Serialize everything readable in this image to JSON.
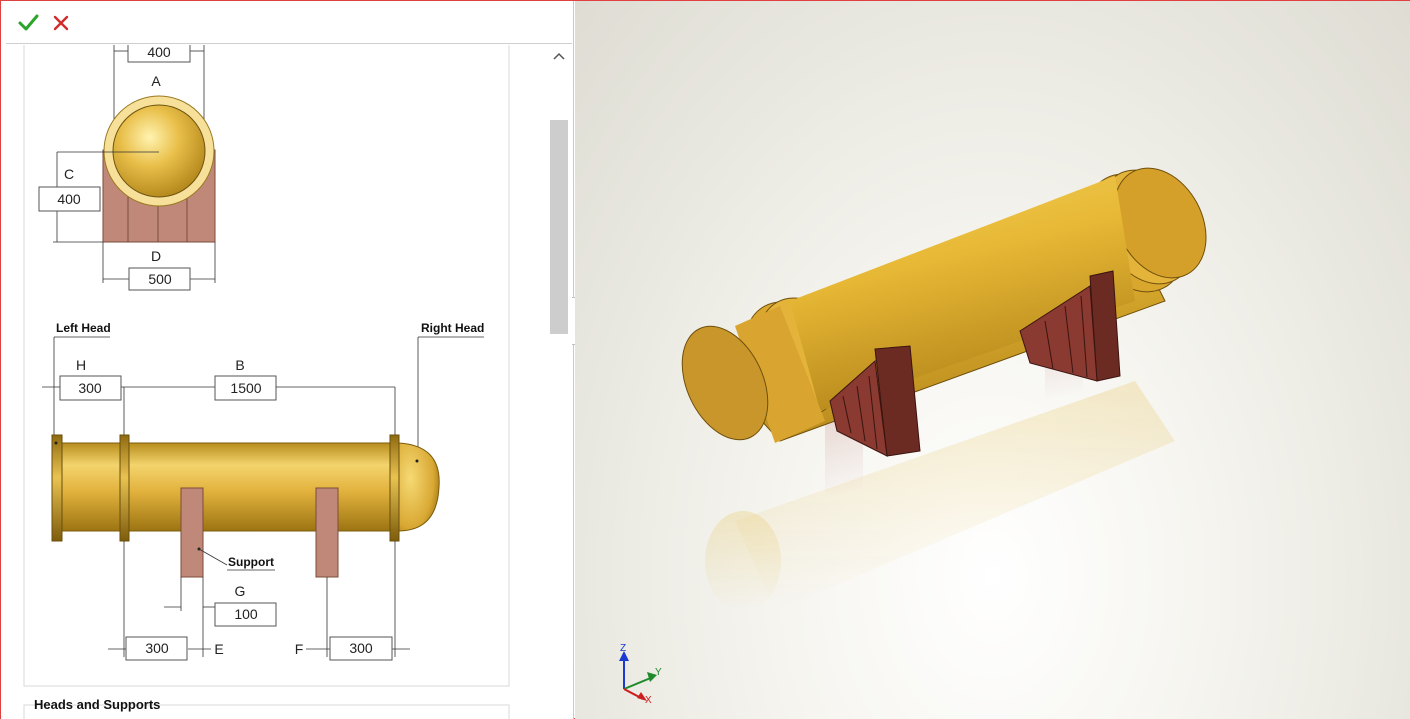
{
  "toolbar": {
    "ok_icon": "checkmark-icon",
    "cancel_icon": "close-icon",
    "ok_color": "#2aa52a",
    "cancel_color": "#d42a2a"
  },
  "diagram": {
    "dim_a_value": "400",
    "dim_a_label": "A",
    "dim_c_value": "400",
    "dim_c_label": "C",
    "dim_d_value": "500",
    "dim_d_label": "D",
    "left_head_label": "Left Head",
    "right_head_label": "Right Head",
    "dim_h_label": "H",
    "dim_h_value": "300",
    "dim_b_label": "B",
    "dim_b_value": "1500",
    "support_label": "Support",
    "dim_g_label": "G",
    "dim_g_value": "100",
    "dim_e_value": "300",
    "dim_e_label": "E",
    "dim_f_label": "F",
    "dim_f_value": "300"
  },
  "section": {
    "title": "Heads and Supports"
  },
  "triad": {
    "z": "Z",
    "y": "Y",
    "x": "X"
  }
}
